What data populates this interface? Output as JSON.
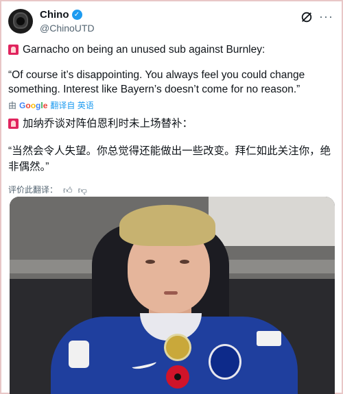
{
  "author": {
    "name": "Chino",
    "handle": "@ChinoUTD",
    "verified": true,
    "verified_color": "#1d9bf0"
  },
  "tweet": {
    "headline_en": "Garnacho on being an unused sub against Burnley:",
    "quote_en": "“Of course it’s disappointing. You always feel you could change something. Interest like Bayern’s doesn’t come for no reason.”",
    "translation_prefix": "由",
    "google_letters": [
      "G",
      "o",
      "o",
      "g",
      "l",
      "e"
    ],
    "translation_action": "翻译自 英语",
    "headline_zh": "加纳乔谈对阵伯恩利时未上场替补：",
    "quote_zh": "“当然会令人失望。你总觉得还能做出一些改变。拜仁如此关注你，绝非偶然。”",
    "rate_label": "评价此翻译：",
    "alarm_icon": "siren-icon",
    "accent_color": "#e0245e"
  },
  "media": {
    "description_icon": "photo"
  }
}
